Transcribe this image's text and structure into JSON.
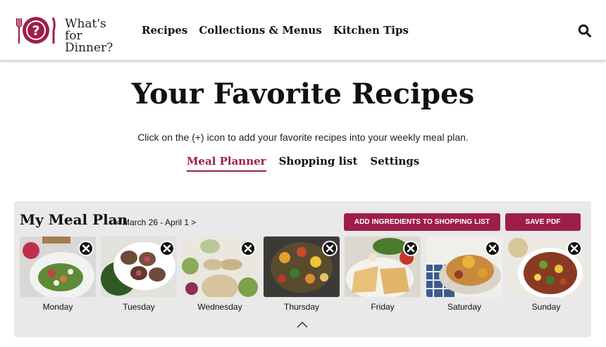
{
  "header": {
    "logo": {
      "line1": "What's",
      "line2": "for Dinner?"
    },
    "nav": [
      {
        "label": "Recipes"
      },
      {
        "label": "Collections & Menus"
      },
      {
        "label": "Kitchen Tips"
      }
    ],
    "search_icon": "search-icon"
  },
  "page": {
    "title": "Your Favorite Recipes",
    "instructions": "Click on the (+) icon to add your favorite recipes into your weekly meal plan.",
    "tabs": [
      {
        "label": "Meal Planner",
        "active": true
      },
      {
        "label": "Shopping list",
        "active": false
      },
      {
        "label": "Settings",
        "active": false
      }
    ]
  },
  "meal_plan": {
    "title": "My Meal Plan",
    "prev": "<",
    "date_range": "March 26 - April 1",
    "next": ">",
    "add_button": "Add ingredients to shopping list",
    "pdf_button": "Save PDF",
    "days": [
      {
        "label": "Monday"
      },
      {
        "label": "Tuesday"
      },
      {
        "label": "Wednesday"
      },
      {
        "label": "Thursday"
      },
      {
        "label": "Friday"
      },
      {
        "label": "Saturday"
      },
      {
        "label": "Sunday"
      }
    ]
  },
  "colors": {
    "brand": "#9e1e4a",
    "panel": "#e9e9e9"
  }
}
